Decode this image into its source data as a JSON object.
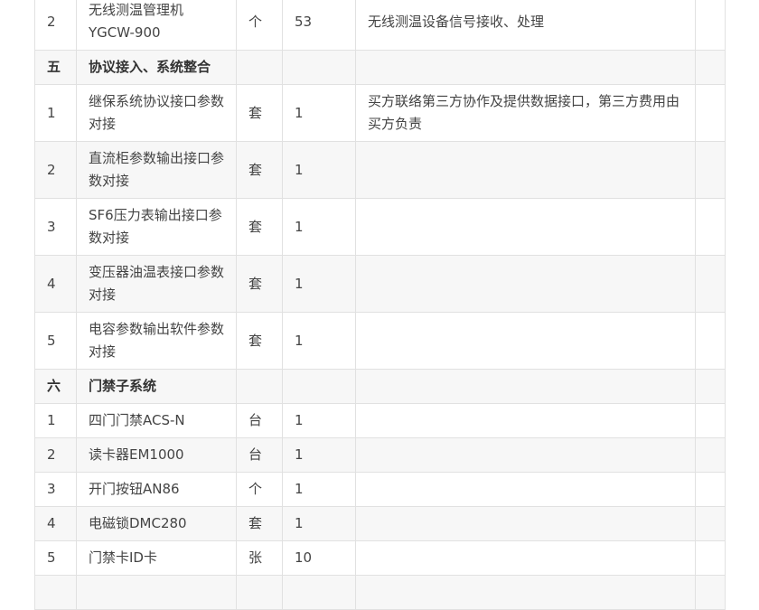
{
  "rows": [
    {
      "kind": "item",
      "num": "2",
      "name": "无线测温管理机YGCW-900",
      "unit": "个",
      "qty": "53",
      "remark": "无线测温设备信号接收、处理",
      "tall": true
    },
    {
      "kind": "section",
      "num": "五",
      "name": "协议接入、系统整合",
      "unit": "",
      "qty": "",
      "remark": "",
      "tall": false
    },
    {
      "kind": "item",
      "num": "1",
      "name": "继保系统协议接口参数对接",
      "unit": "套",
      "qty": "1",
      "remark": "买方联络第三方协作及提供数据接口，第三方费用由买方负责",
      "tall": true
    },
    {
      "kind": "item",
      "num": "2",
      "name": "直流柜参数输出接口参数对接",
      "unit": "套",
      "qty": "1",
      "remark": "",
      "tall": true
    },
    {
      "kind": "item",
      "num": "3",
      "name": "SF6压力表输出接口参数对接",
      "unit": "套",
      "qty": "1",
      "remark": "",
      "tall": true
    },
    {
      "kind": "item",
      "num": "4",
      "name": "变压器油温表接口参数对接",
      "unit": "套",
      "qty": "1",
      "remark": "",
      "tall": true
    },
    {
      "kind": "item",
      "num": "5",
      "name": "电容参数输出软件参数对接",
      "unit": "套",
      "qty": "1",
      "remark": "",
      "tall": true
    },
    {
      "kind": "section",
      "num": "六",
      "name": "门禁子系统",
      "unit": "",
      "qty": "",
      "remark": "",
      "tall": false
    },
    {
      "kind": "item",
      "num": "1",
      "name": "四门门禁ACS-N",
      "unit": "台",
      "qty": "1",
      "remark": "",
      "tall": false
    },
    {
      "kind": "item",
      "num": "2",
      "name": "读卡器EM1000",
      "unit": "台",
      "qty": "1",
      "remark": "",
      "tall": false
    },
    {
      "kind": "item",
      "num": "3",
      "name": "开门按钮AN86",
      "unit": "个",
      "qty": "1",
      "remark": "",
      "tall": false
    },
    {
      "kind": "item",
      "num": "4",
      "name": "电磁锁DMC280",
      "unit": "套",
      "qty": "1",
      "remark": "",
      "tall": false
    },
    {
      "kind": "item",
      "num": "5",
      "name": "门禁卡ID卡",
      "unit": "张",
      "qty": "10",
      "remark": "",
      "tall": false
    },
    {
      "kind": "item",
      "num": "",
      "name": "",
      "unit": "",
      "qty": "",
      "remark": "",
      "tall": false
    }
  ]
}
